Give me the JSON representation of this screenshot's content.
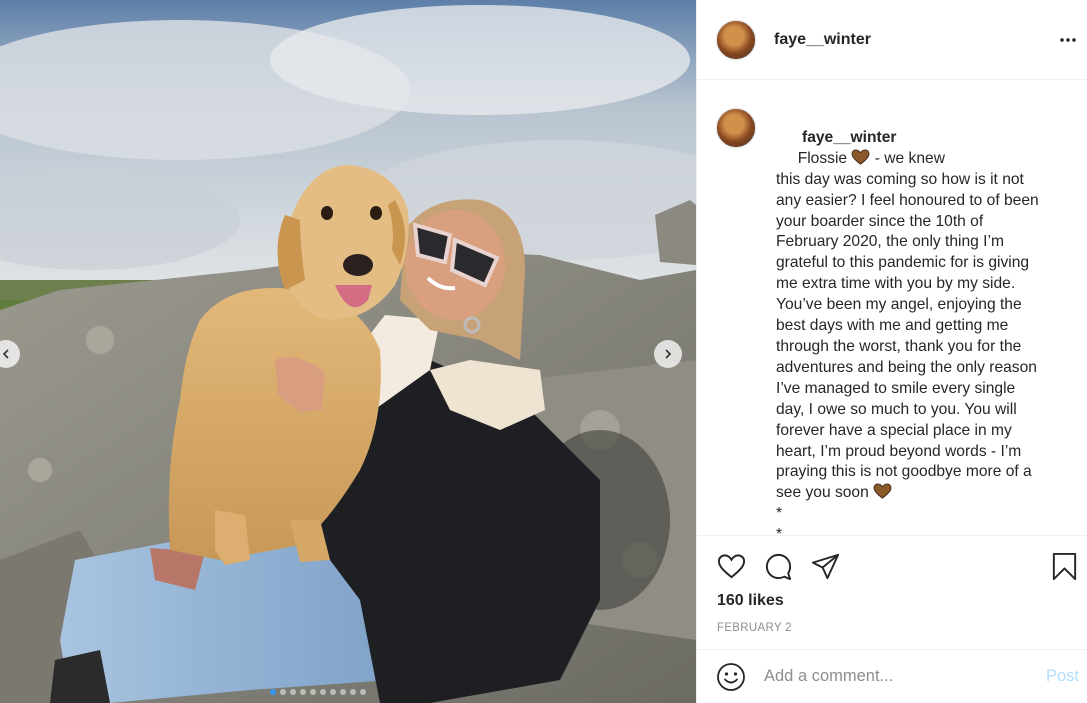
{
  "post": {
    "image_alt": "Woman in sunglasses hugging a golden retriever on granite rocks",
    "author": "faye__winter",
    "caption_lines": [
      [
        "Flossie ",
        "heart",
        " - we knew"
      ],
      [
        "this day was coming so how is it not"
      ],
      [
        "any easier? I feel honoured to of been"
      ],
      [
        "your boarder since the 10th of"
      ],
      [
        "February 2020, the only thing I’m"
      ],
      [
        "grateful to this pandemic for is giving"
      ],
      [
        "me extra time with you by my side."
      ],
      [
        "You’ve been my angel, enjoying the"
      ],
      [
        "best days with me and getting me"
      ],
      [
        "through the worst, thank you for the"
      ],
      [
        "adventures and being the only reason"
      ],
      [
        "I’ve managed to smile every single"
      ],
      [
        "day, I owe so much to you. You will"
      ],
      [
        "forever have a special place in my"
      ],
      [
        "heart, I’m proud beyond words - I’m"
      ],
      [
        "praying this is not goodbye more of a"
      ],
      [
        "see you soon ",
        "heart"
      ],
      [
        "*"
      ],
      [
        "*"
      ],
      [
        "*"
      ]
    ],
    "likes": "160 likes",
    "date": "FEBRUARY 2"
  },
  "comment": {
    "placeholder": "Add a comment...",
    "post_label": "Post"
  },
  "icons": {
    "more": "more-options-icon",
    "like": "heart-icon",
    "comment": "comment-icon",
    "share": "share-icon",
    "save": "bookmark-icon",
    "emoji": "emoji-icon",
    "caption_emoji": "brown-heart-emoji"
  },
  "colors": {
    "accent": "#3897f0",
    "post_disabled": "#b2dffc",
    "muted": "#8e8e8e",
    "text": "#262626",
    "border": "#efefef",
    "brown_heart": "#8b5a2b"
  },
  "carousel": {
    "slide_count": 10,
    "active_index": 0
  }
}
